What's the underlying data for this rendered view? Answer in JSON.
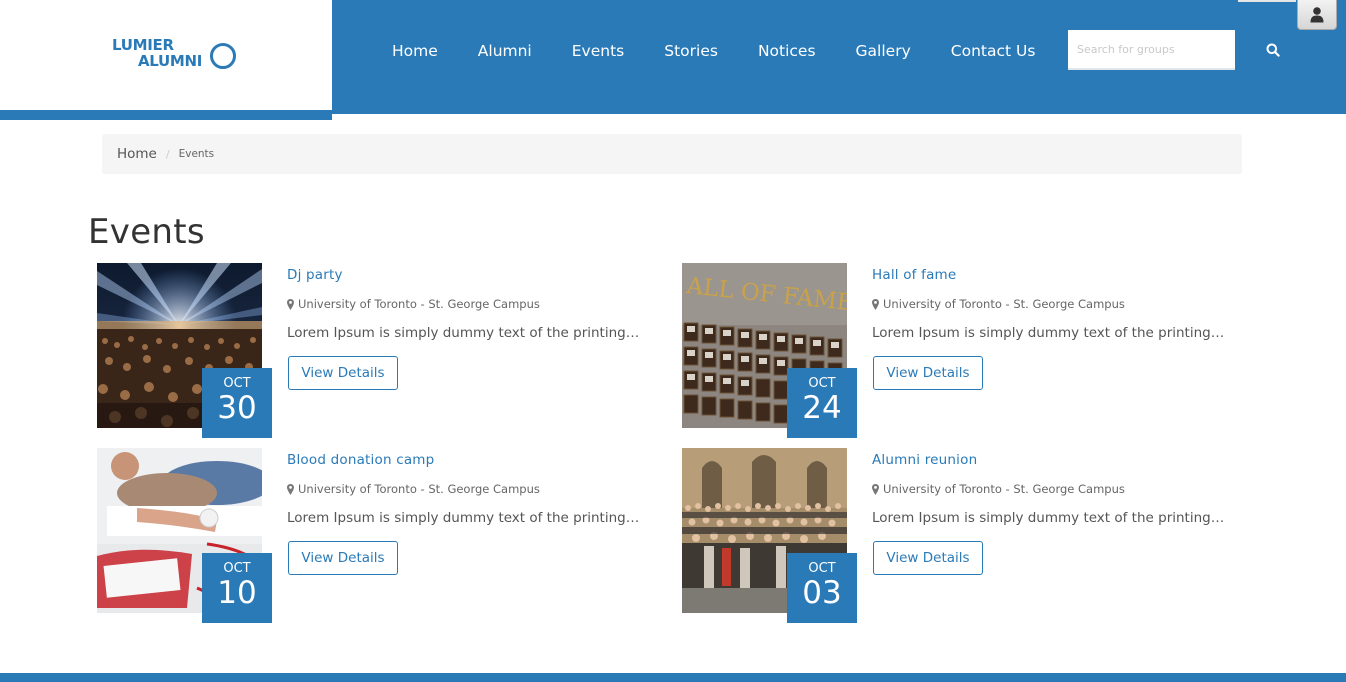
{
  "brand": {
    "line1": "LUMIER",
    "line2": "ALUMNI",
    "color": "#2a7ab8"
  },
  "nav": {
    "items": [
      {
        "label": "Home"
      },
      {
        "label": "Alumni"
      },
      {
        "label": "Events"
      },
      {
        "label": "Stories"
      },
      {
        "label": "Notices"
      },
      {
        "label": "Gallery"
      },
      {
        "label": "Contact Us"
      }
    ]
  },
  "search": {
    "placeholder": "Search for groups",
    "value": "",
    "icon": "search-icon"
  },
  "user": {
    "icon": "user-icon"
  },
  "breadcrumb": {
    "home": "Home",
    "separator": "/",
    "current": "Events"
  },
  "page": {
    "title": "Events"
  },
  "events": [
    {
      "title": "Dj party",
      "location": "University of Toronto - St. George Campus",
      "description": "Lorem Ipsum is simply dummy text of the printing and typesetting industry.",
      "month": "OCT",
      "day": "30",
      "button": "View Details"
    },
    {
      "title": "Hall of fame",
      "location": "University of Toronto - St. George Campus",
      "description": "Lorem Ipsum is simply dummy text of the printing and typesetting industry.",
      "month": "OCT",
      "day": "24",
      "button": "View Details",
      "image_text": "ALL OF FAME"
    },
    {
      "title": "Blood donation camp",
      "location": "University of Toronto - St. George Campus",
      "description": "Lorem Ipsum is simply dummy text of the printing and typesetting industry.",
      "month": "OCT",
      "day": "10",
      "button": "View Details"
    },
    {
      "title": "Alumni reunion",
      "location": "University of Toronto - St. George Campus",
      "description": "Lorem Ipsum is simply dummy text of the printing and typesetting industry.",
      "month": "OCT",
      "day": "03",
      "button": "View Details"
    }
  ],
  "colors": {
    "accent": "#2a7ab8",
    "breadcrumb_bg": "#f5f5f5"
  }
}
